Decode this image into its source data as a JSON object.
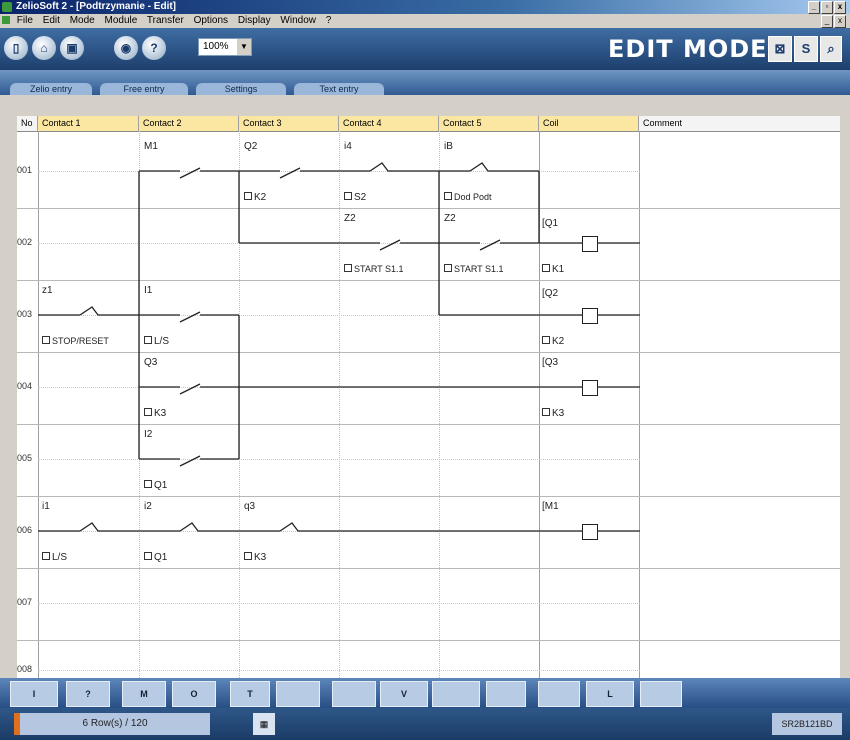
{
  "window": {
    "title": "ZelioSoft 2 - [Podtrzymanie - Edit]"
  },
  "menu": [
    "File",
    "Edit",
    "Mode",
    "Module",
    "Transfer",
    "Options",
    "Display",
    "Window",
    "?"
  ],
  "toolbar": {
    "zoom": "100%",
    "mode_label": "EDIT MODE"
  },
  "tabs": [
    "Zelio entry",
    "Free entry",
    "Settings",
    "Text entry"
  ],
  "columns": [
    "No",
    "Contact 1",
    "Contact 2",
    "Contact 3",
    "Contact 4",
    "Contact 5",
    "Coil",
    "Comment"
  ],
  "rows": [
    "001",
    "002",
    "003",
    "004",
    "005",
    "006",
    "007",
    "008"
  ],
  "labels": {
    "r1c2": "M1",
    "r1c3": "Q2",
    "r1c3b": "K2",
    "r1c4": "i4",
    "r1c4b": "S2",
    "r1c5": "iB",
    "r1c5b": "Dod Podt",
    "r2c4": "Z2",
    "r2c4b": "START S1.1",
    "r2c5": "Z2",
    "r2c5b": "START S1.1",
    "r2coil": "Q1",
    "r2coilb": "K1",
    "r3c1": "z1",
    "r3c1b": "STOP/RESET",
    "r3c2": "I1",
    "r3c2b": "L/S",
    "r3coil": "Q2",
    "r3coilb": "K2",
    "r4c2": "Q3",
    "r4c2b": "K3",
    "r4coil": "Q3",
    "r4coilb": "K3",
    "r5c2": "I2",
    "r5c2b": "Q1",
    "r6c1": "i1",
    "r6c1b": "L/S",
    "r6c2": "i2",
    "r6c2b": "Q1",
    "r6c3": "q3",
    "r6c3b": "K3",
    "r6coil": "M1"
  },
  "bottom_toolbar": [
    "I",
    "?",
    "M",
    "O",
    "T",
    "",
    "",
    "V",
    "",
    "",
    "",
    "L",
    ""
  ],
  "status": {
    "rows": "6 Row(s) / 120",
    "module": "SR2B121BD"
  }
}
